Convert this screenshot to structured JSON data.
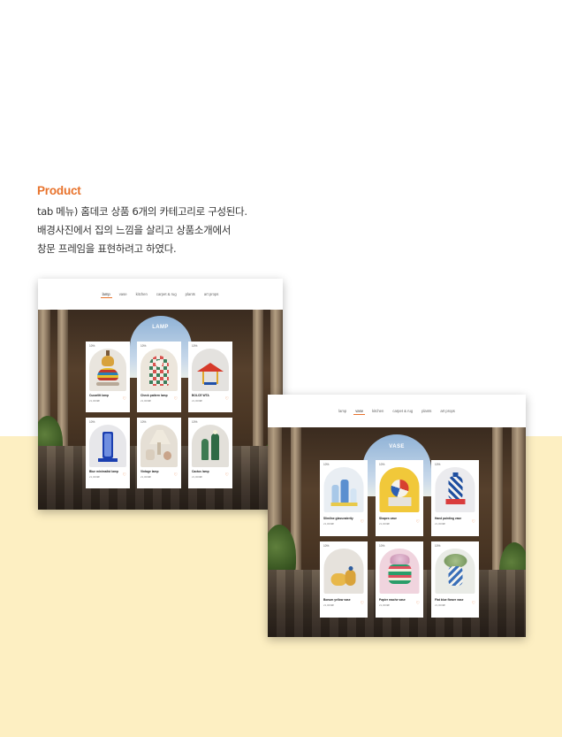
{
  "intro": {
    "heading": "Product",
    "lines": [
      "tab 메뉴) 홈데코 상품 6개의 카테고리로 구성된다.",
      "배경사진에서 집의 느낌을 살리고 상품소개에서",
      "창문 프레임을 표현하려고 하였다."
    ]
  },
  "colors": {
    "accent": "#e8732c",
    "band": "#fdefc2"
  },
  "mockups": [
    {
      "tabs": [
        "lamp",
        "vase",
        "kitchen",
        "carpet & rug",
        "plants",
        "art props"
      ],
      "active_tab": "lamp",
      "banner": "LAMP",
      "products": [
        {
          "discount": "10%",
          "name": "Cucarlitt lamp",
          "price": "21,000₩",
          "icon": "heart-icon"
        },
        {
          "discount": "10%",
          "name": "Check pattern lamp",
          "price": "21,000₩",
          "icon": "heart-icon"
        },
        {
          "discount": "10%",
          "name": "BOLCE WTA",
          "price": "21,000₩",
          "icon": "heart-icon"
        },
        {
          "discount": "10%",
          "name": "Blue minimalist lamp",
          "price": "21,000₩",
          "icon": "heart-icon"
        },
        {
          "discount": "10%",
          "name": "Vintage lamp",
          "price": "21,000₩",
          "icon": "heart-icon"
        },
        {
          "discount": "10%",
          "name": "Cactus lamp",
          "price": "21,000₩",
          "icon": "heart-icon"
        }
      ]
    },
    {
      "tabs": [
        "lamp",
        "vase",
        "kitchen",
        "carpet & rug",
        "plants",
        "art props"
      ],
      "active_tab": "vase",
      "banner": "VASE",
      "products": [
        {
          "discount": "10%",
          "name": "Slimline glassvaterity",
          "price": "21,000₩",
          "icon": "heart-icon"
        },
        {
          "discount": "10%",
          "name": "Shapes vase",
          "price": "21,000₩",
          "icon": "heart-icon"
        },
        {
          "discount": "10%",
          "name": "Hand painting vase",
          "price": "21,000₩",
          "icon": "heart-icon"
        },
        {
          "discount": "10%",
          "name": "Bonum yellow vase",
          "price": "21,000₩",
          "icon": "heart-icon"
        },
        {
          "discount": "10%",
          "name": "Papier mache vase",
          "price": "21,000₩",
          "icon": "heart-icon"
        },
        {
          "discount": "10%",
          "name": "Flat blue flower vase",
          "price": "21,000₩",
          "icon": "heart-icon"
        }
      ]
    }
  ]
}
